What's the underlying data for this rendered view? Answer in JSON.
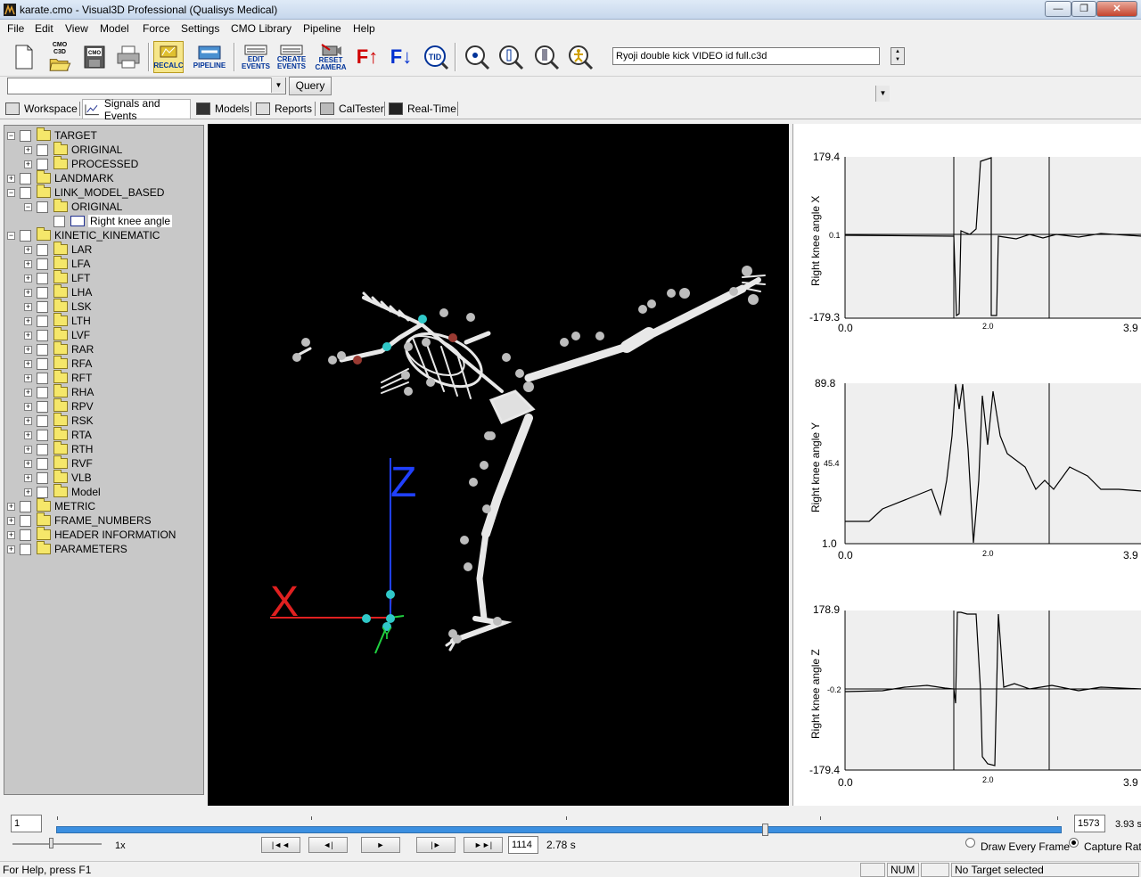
{
  "window": {
    "title": "karate.cmo - Visual3D Professional (Qualisys Medical)",
    "min_btn": "—",
    "max_btn": "❐",
    "close_btn": "✕"
  },
  "menu": [
    "File",
    "Edit",
    "View",
    "Model",
    "Force",
    "Settings",
    "CMO Library",
    "Pipeline",
    "Help"
  ],
  "toolbar": {
    "cmo_c3d": "CMO C3D",
    "cmo": "CMO",
    "recalc": "RECALC",
    "pipeline": "PIPELINE",
    "edit_events": "EDIT EVENTS",
    "create_events": "CREATE EVENTS",
    "reset_camera": "RESET CAMERA",
    "f_up": "F",
    "f_down": "F",
    "tid": "TID",
    "file_combo_value": "Ryoji double kick VIDEO id full.c3d"
  },
  "query": {
    "value": "",
    "button": "Query"
  },
  "tabs": [
    "Workspace",
    "Signals and Events",
    "Models",
    "Reports",
    "CalTester",
    "Real-Time"
  ],
  "tree": [
    {
      "label": "TARGET",
      "level": 0,
      "exp": "−",
      "type": "folder"
    },
    {
      "label": "ORIGINAL",
      "level": 1,
      "exp": "+",
      "type": "folder"
    },
    {
      "label": "PROCESSED",
      "level": 1,
      "exp": "+",
      "type": "folder"
    },
    {
      "label": "LANDMARK",
      "level": 0,
      "exp": "+",
      "type": "folder"
    },
    {
      "label": "LINK_MODEL_BASED",
      "level": 0,
      "exp": "−",
      "type": "folder"
    },
    {
      "label": "ORIGINAL",
      "level": 1,
      "exp": "−",
      "type": "folder"
    },
    {
      "label": "Right knee angle",
      "level": 2,
      "exp": "",
      "type": "signal"
    },
    {
      "label": "KINETIC_KINEMATIC",
      "level": 0,
      "exp": "−",
      "type": "folder"
    },
    {
      "label": "LAR",
      "level": 1,
      "exp": "+",
      "type": "folder"
    },
    {
      "label": "LFA",
      "level": 1,
      "exp": "+",
      "type": "folder"
    },
    {
      "label": "LFT",
      "level": 1,
      "exp": "+",
      "type": "folder"
    },
    {
      "label": "LHA",
      "level": 1,
      "exp": "+",
      "type": "folder"
    },
    {
      "label": "LSK",
      "level": 1,
      "exp": "+",
      "type": "folder"
    },
    {
      "label": "LTH",
      "level": 1,
      "exp": "+",
      "type": "folder"
    },
    {
      "label": "LVF",
      "level": 1,
      "exp": "+",
      "type": "folder"
    },
    {
      "label": "RAR",
      "level": 1,
      "exp": "+",
      "type": "folder"
    },
    {
      "label": "RFA",
      "level": 1,
      "exp": "+",
      "type": "folder"
    },
    {
      "label": "RFT",
      "level": 1,
      "exp": "+",
      "type": "folder"
    },
    {
      "label": "RHA",
      "level": 1,
      "exp": "+",
      "type": "folder"
    },
    {
      "label": "RPV",
      "level": 1,
      "exp": "+",
      "type": "folder"
    },
    {
      "label": "RSK",
      "level": 1,
      "exp": "+",
      "type": "folder"
    },
    {
      "label": "RTA",
      "level": 1,
      "exp": "+",
      "type": "folder"
    },
    {
      "label": "RTH",
      "level": 1,
      "exp": "+",
      "type": "folder"
    },
    {
      "label": "RVF",
      "level": 1,
      "exp": "+",
      "type": "folder"
    },
    {
      "label": "VLB",
      "level": 1,
      "exp": "+",
      "type": "folder"
    },
    {
      "label": "Model",
      "level": 1,
      "exp": "+",
      "type": "folder"
    },
    {
      "label": "METRIC",
      "level": 0,
      "exp": "+",
      "type": "folder"
    },
    {
      "label": "FRAME_NUMBERS",
      "level": 0,
      "exp": "+",
      "type": "folder"
    },
    {
      "label": "HEADER INFORMATION",
      "level": 0,
      "exp": "+",
      "type": "folder"
    },
    {
      "label": "PARAMETERS",
      "level": 0,
      "exp": "+",
      "type": "folder"
    }
  ],
  "viewport": {
    "axis_x": "X",
    "axis_y": "Y",
    "axis_z": "Z"
  },
  "graphs": [
    {
      "ylabel": "Right knee angle X",
      "ymax": "179.4",
      "ymid": "0.1",
      "ymin": "-179.3",
      "xmin": "0.0",
      "xmid": "2.0",
      "xmax": "3.9"
    },
    {
      "ylabel": "Right knee angle Y",
      "ymax": "89.8",
      "ymid": "45.4",
      "ymin": "1.0",
      "xmin": "0.0",
      "xmid": "2.0",
      "xmax": "3.9"
    },
    {
      "ylabel": "Right knee angle Z",
      "ymax": "178.9",
      "ymid": "-0.2",
      "ymin": "-179.4",
      "xmin": "0.0",
      "xmid": "2.0",
      "xmax": "3.9"
    }
  ],
  "playback": {
    "start_frame": "1",
    "end_frame": "1573",
    "end_time": "3.93 s",
    "current_frame": "1114",
    "current_time": "2.78 s",
    "speed": "1x",
    "draw_every_frame": "Draw Every Frame",
    "capture_rate": "Capture Rate",
    "buttons": [
      "|◄◄",
      "◄|",
      "►",
      "|►",
      "►►|"
    ]
  },
  "status": {
    "help": "For Help, press F1",
    "num": "NUM",
    "target": "No Target selected"
  }
}
